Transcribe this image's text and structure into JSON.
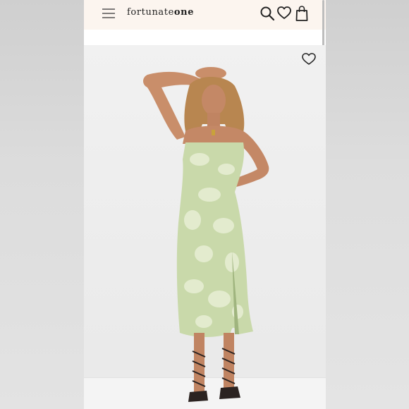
{
  "header": {
    "logo_light": "fortunate",
    "logo_bold": "one",
    "icons": [
      "hamburger-menu-icon",
      "search-icon",
      "heart-icon",
      "shopping-bag-icon"
    ]
  },
  "product_image": {
    "wishlist_icon": "heart-outline-icon",
    "dress_color": "#c9d9aa",
    "print_color": "#e6eed3"
  },
  "colors": {
    "header_bg": "#fcf5ef",
    "icon": "#222222"
  }
}
